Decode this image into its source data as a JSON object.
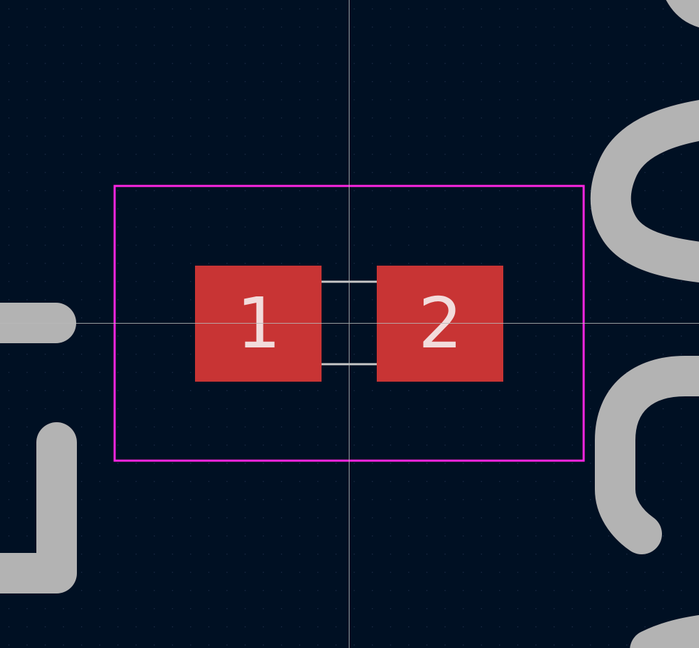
{
  "pads": [
    {
      "label": "1"
    },
    {
      "label": "2"
    }
  ],
  "colors": {
    "background": "#001023",
    "grid_dot": "#1a2a44",
    "crosshair": "#b8b8b8",
    "courtyard": "#ff26e2",
    "pad_fill": "#c83434",
    "pad_text": "#f2dcdc",
    "silkscreen_track": "#b3b3b3",
    "fab_line": "#c8c8c8"
  }
}
